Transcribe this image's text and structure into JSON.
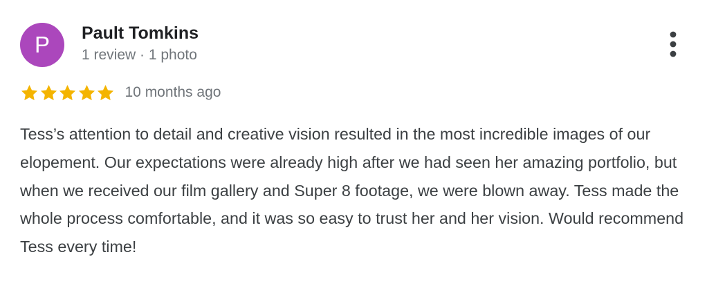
{
  "review": {
    "avatar_letter": "P",
    "avatar_color": "#ab47bc",
    "reviewer_name": "Pault Tomkins",
    "reviewer_meta": "1 review · 1 photo",
    "rating": 5,
    "rating_max": 5,
    "star_color": "#f4b400",
    "date": "10 months ago",
    "text": "Tess’s attention to detail and creative vision resulted in the most incredible images of our elopement. Our expectations were already high after we had seen her amazing portfolio, but when we received our film gallery and Super 8 footage, we were blown away. Tess made the whole process comfortable, and it was so easy to trust her and her vision. Would recommend Tess every time!",
    "more_icon": "more-vert-icon"
  }
}
